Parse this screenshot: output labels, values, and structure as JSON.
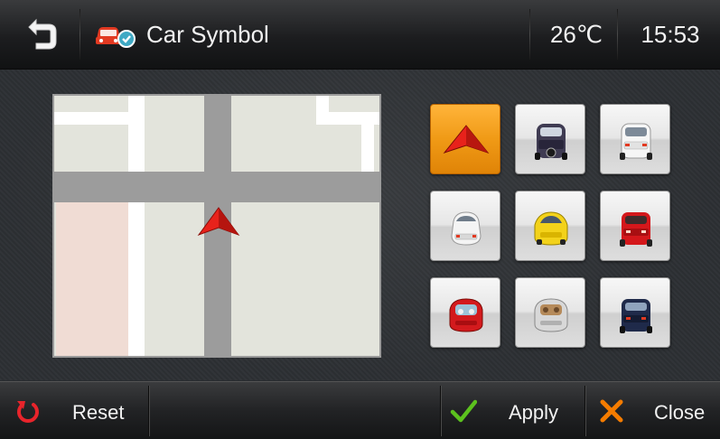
{
  "header": {
    "title": "Car Symbol",
    "temperature": "26℃",
    "time": "15:53",
    "back_icon": "back-arrow-icon",
    "title_icon": "car-check-icon"
  },
  "car_symbols": [
    {
      "name": "red-arrow",
      "selected": true
    },
    {
      "name": "dark-suv-rear"
    },
    {
      "name": "white-suv-rear"
    },
    {
      "name": "white-sedan"
    },
    {
      "name": "yellow-sports-car"
    },
    {
      "name": "red-sedan"
    },
    {
      "name": "red-convertible"
    },
    {
      "name": "silver-convertible"
    },
    {
      "name": "navy-sedan"
    }
  ],
  "footer": {
    "reset_label": "Reset",
    "apply_label": "Apply",
    "close_label": "Close"
  },
  "colors": {
    "accent": "#f09a16",
    "reset_icon": "#e8242b",
    "apply_icon": "#5cc21e",
    "close_icon": "#f57c00",
    "map_road": "#9c9c9c"
  }
}
